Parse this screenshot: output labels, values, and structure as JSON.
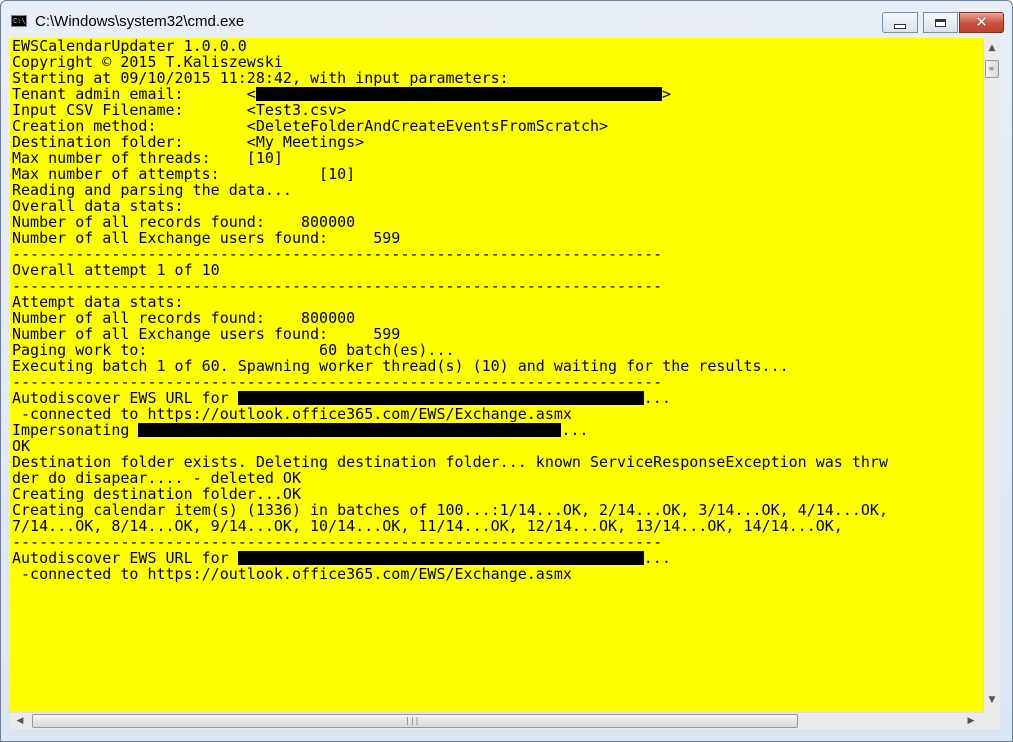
{
  "window": {
    "title": "C:\\Windows\\system32\\cmd.exe",
    "app_icon_text": "C:\\",
    "controls": {
      "minimize_icon": "minimize-icon",
      "maximize_icon": "maximize-icon",
      "close_icon": "close-icon",
      "close_glyph": "✕"
    }
  },
  "console": {
    "background": "#ffff00",
    "text_color": "#000000",
    "lines": {
      "l01": "EWSCalendarUpdater 1.0.0.0",
      "l02": "Copyright © 2015 T.Kaliszewski",
      "l03": "",
      "l04": "Starting at 09/10/2015 11:28:42, with input parameters:",
      "l05": "",
      "l06a": "Tenant admin email:       <",
      "l06b": ">",
      "l07": "Input CSV Filename:       <Test3.csv>",
      "l08": "Creation method:          <DeleteFolderAndCreateEventsFromScratch>",
      "l09": "Destination folder:       <My Meetings>",
      "l10": "Max number of threads:    [10]",
      "l11": "Max number of attempts:           [10]",
      "l12": "",
      "l13": "Reading and parsing the data...",
      "l14": "Overall data stats:",
      "l15": "Number of all records found:    800000",
      "l16": "Number of all Exchange users found:     599",
      "l17": "",
      "l18": "------------------------------------------------------------------------",
      "l19": "Overall attempt 1 of 10",
      "l20": "------------------------------------------------------------------------",
      "l21": "Attempt data stats:",
      "l22": "Number of all records found:    800000",
      "l23": "Number of all Exchange users found:     599",
      "l24": "",
      "l25": "Paging work to:                   60 batch(es)...",
      "l26": "",
      "l27": "Executing batch 1 of 60. Spawning worker thread(s) (10) and waiting for the results...",
      "l28": "",
      "l29": "------------------------------------------------------------------------",
      "l30a": "Autodiscover EWS URL for ",
      "l30b": "...",
      "l31": " -connected to https://outlook.office365.com/EWS/Exchange.asmx",
      "l32a": "Impersonating ",
      "l32b": "...",
      "l33": "OK",
      "l34": "Destination folder exists. Deleting destination folder... known ServiceResponseException was thrw",
      "l35": "der do disapear.... - deleted OK",
      "l36": "Creating destination folder...OK",
      "l37": "Creating calendar item(s) (1336) in batches of 100...:1/14...OK, 2/14...OK, 3/14...OK, 4/14...OK,",
      "l38": "7/14...OK, 8/14...OK, 9/14...OK, 10/14...OK, 11/14...OK, 12/14...OK, 13/14...OK, 14/14...OK,",
      "l39": "------------------------------------------------------------------------",
      "l40": "",
      "l41a": "Autodiscover EWS URL for ",
      "l41b": "...",
      "l42": " -connected to https://outlook.office365.com/EWS/Exchange.asmx"
    }
  },
  "scrollbars": {
    "up_arrow": "▲",
    "down_arrow": "▼",
    "left_arrow": "◀",
    "right_arrow": "▶",
    "v_grip": "≡",
    "h_grip": "|||"
  }
}
